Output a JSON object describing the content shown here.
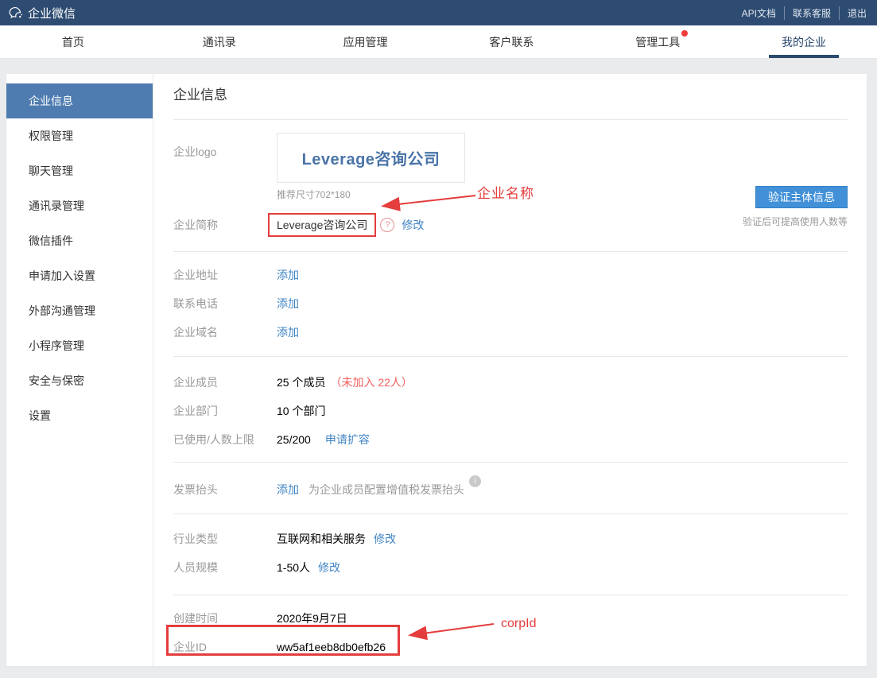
{
  "topbar": {
    "brand": "企业微信",
    "links": [
      "API文档",
      "联系客服",
      "退出"
    ]
  },
  "nav": {
    "tabs": [
      {
        "label": "首页"
      },
      {
        "label": "通讯录"
      },
      {
        "label": "应用管理"
      },
      {
        "label": "客户联系"
      },
      {
        "label": "管理工具",
        "badge": true
      },
      {
        "label": "我的企业",
        "active": true
      }
    ]
  },
  "sidebar": {
    "items": [
      {
        "label": "企业信息",
        "active": true
      },
      {
        "label": "权限管理"
      },
      {
        "label": "聊天管理"
      },
      {
        "label": "通讯录管理"
      },
      {
        "label": "微信插件"
      },
      {
        "label": "申请加入设置"
      },
      {
        "label": "外部沟通管理"
      },
      {
        "label": "小程序管理"
      },
      {
        "label": "安全与保密"
      },
      {
        "label": "设置"
      }
    ]
  },
  "main": {
    "title": "企业信息",
    "logo": {
      "label": "企业logo",
      "text": "Leverage咨询公司",
      "hint": "推荐尺寸702*180"
    },
    "verify": {
      "button": "验证主体信息",
      "note": "验证后可提高使用人数等"
    },
    "shortname": {
      "label": "企业简称",
      "value": "Leverage咨询公司",
      "help_icon": "?",
      "edit": "修改"
    },
    "address": {
      "label": "企业地址",
      "add": "添加"
    },
    "phone": {
      "label": "联系电话",
      "add": "添加"
    },
    "domain": {
      "label": "企业域名",
      "add": "添加"
    },
    "members": {
      "label": "企业成员",
      "value": "25 个成员",
      "note": "（未加入 22人）"
    },
    "departments": {
      "label": "企业部门",
      "value": "10 个部门"
    },
    "usage": {
      "label": "已使用/人数上限",
      "value": "25/200",
      "link": "申请扩容"
    },
    "invoice": {
      "label": "发票抬头",
      "add": "添加",
      "desc": "为企业成员配置增值税发票抬头",
      "info_icon": "i"
    },
    "industry": {
      "label": "行业类型",
      "value": "互联网和相关服务",
      "edit": "修改"
    },
    "scale": {
      "label": "人员规模",
      "value": "1-50人",
      "edit": "修改"
    },
    "created": {
      "label": "创建时间",
      "value": "2020年9月7日"
    },
    "corpid": {
      "label": "企业ID",
      "value": "ww5af1eeb8db0efb26"
    },
    "annotations": {
      "name": "企业名称",
      "corpid": "corpId"
    }
  },
  "colors": {
    "topbar_bg": "#2e4c72",
    "active_nav": "#2b4a6f",
    "sidebar_active_bg": "#4f7cb0",
    "link_blue": "#4084c4",
    "button_blue": "#4190d8",
    "markup_red": "#e43d3d",
    "note_red": "#f25e5e",
    "label_gray": "#999999",
    "logo_text_blue": "#4a74a8"
  }
}
